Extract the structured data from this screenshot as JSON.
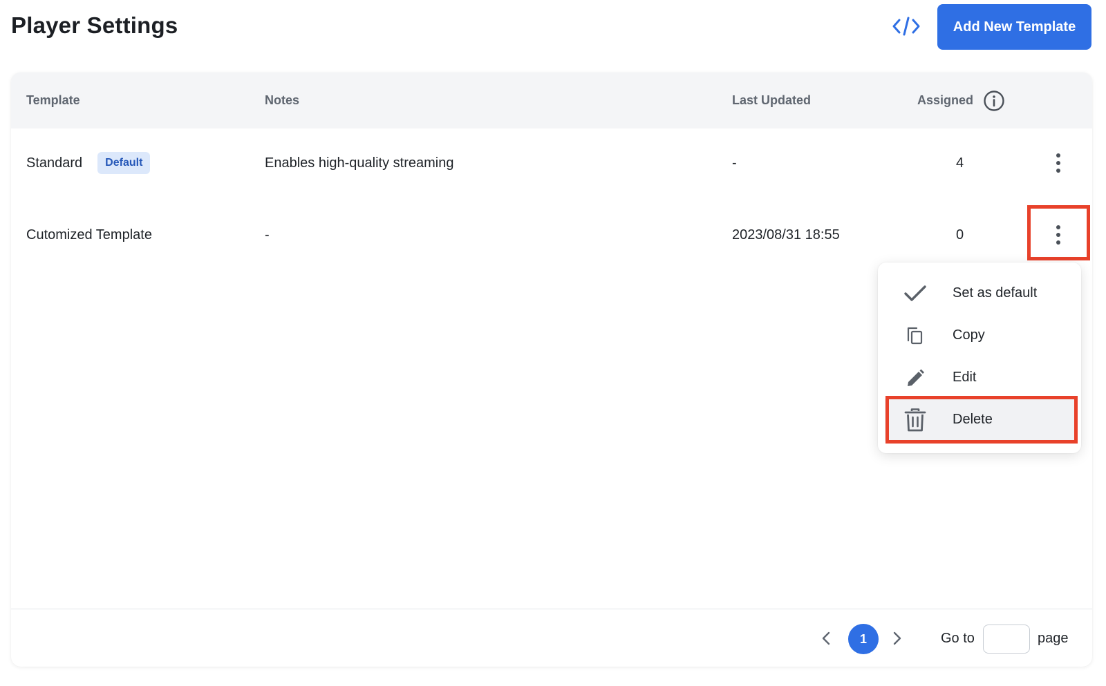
{
  "header": {
    "title": "Player Settings",
    "embed_icon": "code-embed-icon",
    "add_button_label": "Add New Template"
  },
  "table": {
    "columns": {
      "template": "Template",
      "notes": "Notes",
      "last_updated": "Last Updated",
      "assigned": "Assigned"
    },
    "rows": [
      {
        "template": "Standard",
        "badge": "Default",
        "notes": "Enables high-quality streaming",
        "last_updated": "-",
        "assigned": "4"
      },
      {
        "template": "Cutomized Template",
        "badge": "",
        "notes": "-",
        "last_updated": "2023/08/31 18:55",
        "assigned": "0"
      }
    ]
  },
  "row_menu": {
    "items": [
      {
        "label": "Set as default",
        "icon": "checkmark-icon"
      },
      {
        "label": "Copy",
        "icon": "copy-icon"
      },
      {
        "label": "Edit",
        "icon": "pencil-icon"
      },
      {
        "label": "Delete",
        "icon": "trash-icon"
      }
    ]
  },
  "pagination": {
    "current_page": "1",
    "goto_prefix": "Go to",
    "goto_suffix": "page",
    "goto_value": ""
  },
  "colors": {
    "accent": "#2f6fe4",
    "highlight": "#e8412a",
    "badge_bg": "#dce8fb",
    "badge_text": "#2557b8"
  }
}
